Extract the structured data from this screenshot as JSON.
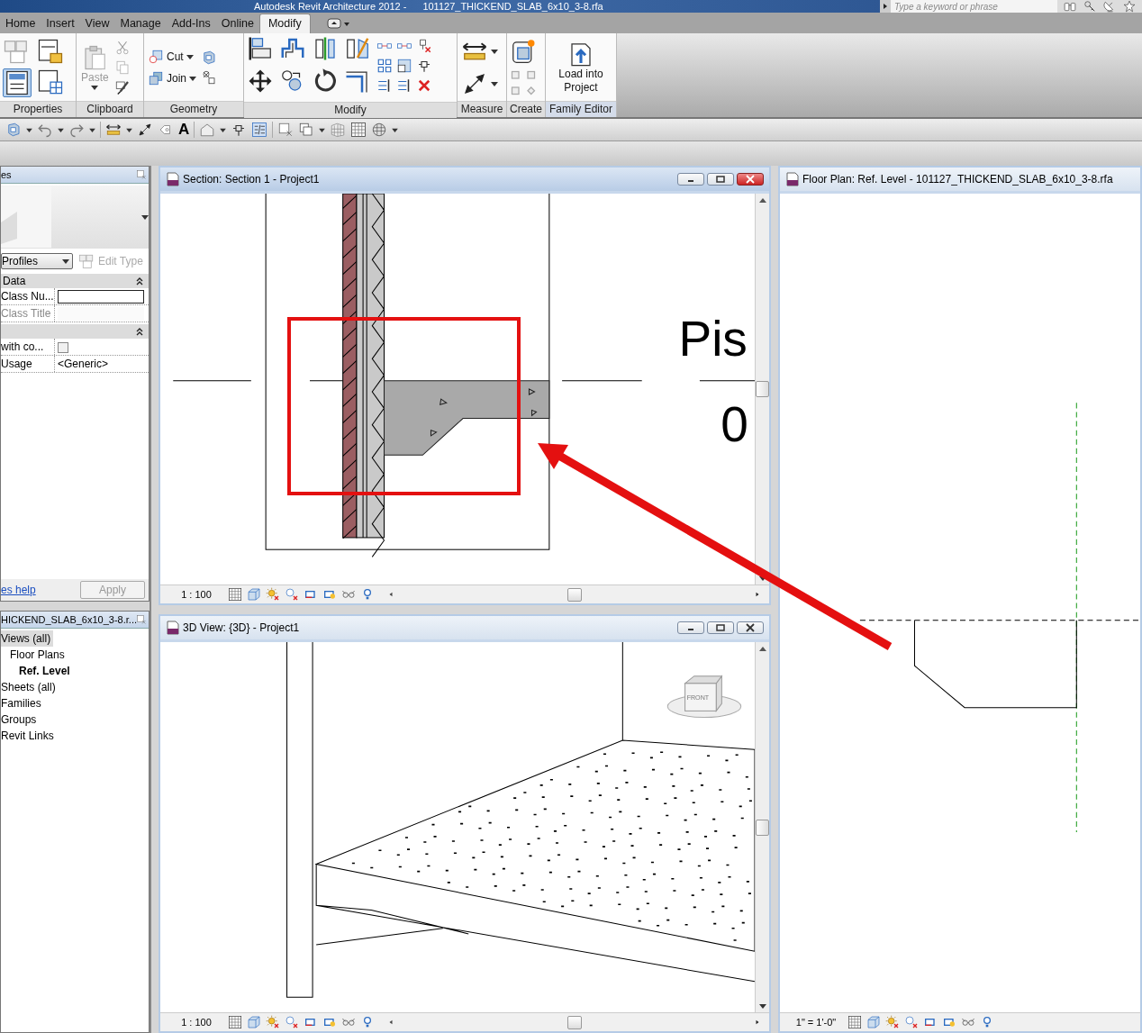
{
  "window": {
    "app": "Autodesk Revit Architecture 2012 -",
    "file": "101127_THICKEND_SLAB_6x10_3-8.rfa"
  },
  "search": {
    "placeholder": "Type a keyword or phrase"
  },
  "tabs": [
    {
      "label": "Home",
      "selected": false
    },
    {
      "label": "Insert",
      "selected": false
    },
    {
      "label": "View",
      "selected": false
    },
    {
      "label": "Manage",
      "selected": false
    },
    {
      "label": "Add-Ins",
      "selected": false
    },
    {
      "label": "Online",
      "selected": false
    },
    {
      "label": "Modify",
      "selected": true
    }
  ],
  "ribbon": {
    "panels": [
      {
        "title": "Properties",
        "kind": "properties"
      },
      {
        "title": "Clipboard",
        "kind": "clipboard",
        "buttons": [
          {
            "label": "Paste",
            "disabled": true
          }
        ]
      },
      {
        "title": "Geometry",
        "kind": "geometry",
        "buttons": [
          {
            "label": "Cut",
            "disabled": false
          },
          {
            "label": "Join",
            "disabled": false
          }
        ]
      },
      {
        "title": "Modify",
        "kind": "modify"
      },
      {
        "title": "Measure",
        "kind": "measure"
      },
      {
        "title": "Create",
        "kind": "create"
      },
      {
        "title": "Family Editor",
        "kind": "family",
        "buttons": [
          {
            "label": "Load into Project",
            "disabled": false
          }
        ]
      }
    ]
  },
  "quick_access": {
    "text_tool": "A"
  },
  "properties": {
    "title": "es",
    "type_selector": "Profiles",
    "edit_type": {
      "label": "Edit Type",
      "disabled": true
    },
    "groups": [
      {
        "label": "Data",
        "expanded": true,
        "rows": [
          {
            "name": "Class Nu...",
            "kind": "field",
            "disabled": false
          },
          {
            "name": "Class Title",
            "kind": "field",
            "disabled": true
          }
        ]
      },
      {
        "expanded": true,
        "rows": [
          {
            "name": "with co...",
            "kind": "checkbox",
            "checked": false
          },
          {
            "name": "Usage",
            "kind": "text",
            "value": "<Generic>"
          }
        ]
      }
    ],
    "help_link": "es help",
    "apply": {
      "label": "Apply",
      "disabled": true
    }
  },
  "project_browser": {
    "title": "HICKEND_SLAB_6x10_3-8.r...",
    "tree": [
      {
        "label": "Views (all)",
        "selected": true,
        "current": false,
        "children": [
          {
            "label": "Floor Plans",
            "selected": false,
            "current": false,
            "children": [
              {
                "label": "Ref. Level",
                "selected": false,
                "current": true
              }
            ]
          }
        ]
      },
      {
        "label": "Sheets (all)",
        "selected": false,
        "current": false
      },
      {
        "label": "Families",
        "selected": false,
        "current": false
      },
      {
        "label": "Groups",
        "selected": false,
        "current": false
      },
      {
        "label": "Revit Links",
        "selected": false,
        "current": false
      }
    ]
  },
  "views": [
    {
      "kind": "section",
      "title": "Section: Section 1 - Project1",
      "active": true,
      "scale": "1 : 100",
      "labels": [
        "Pis",
        "0"
      ]
    },
    {
      "kind": "model",
      "title": "3D View: {3D} - Project1",
      "active": false,
      "scale": "1 : 100",
      "cube_face": "FRONT"
    },
    {
      "kind": "plan",
      "title": "Floor Plan: Ref. Level - 101127_THICKEND_SLAB_6x10_3-8.rfa",
      "scale": "1\" = 1'-0\""
    }
  ]
}
